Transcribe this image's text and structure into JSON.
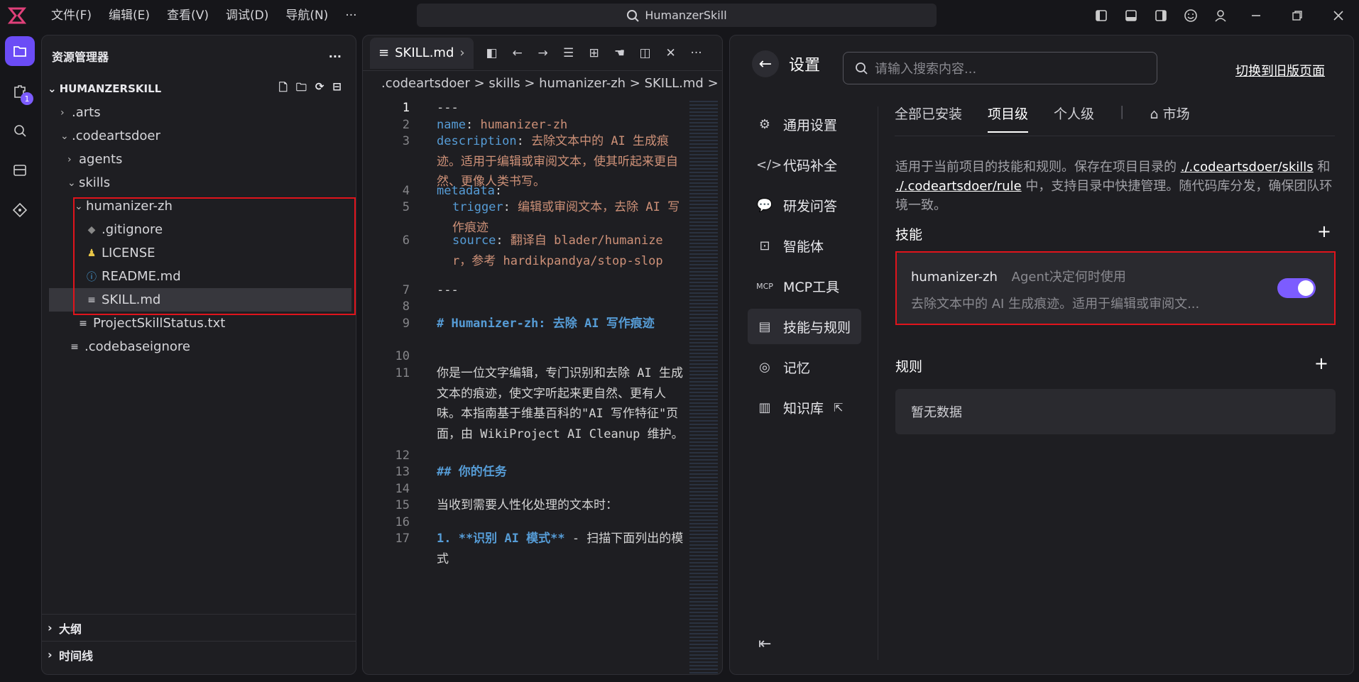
{
  "app": {
    "title": "HumanzerSkill"
  },
  "menu": [
    "文件(F)",
    "编辑(E)",
    "查看(V)",
    "调试(D)",
    "导航(N)",
    "···"
  ],
  "explorer": {
    "title": "资源管理器",
    "more": "···",
    "root": "HUMANZERSKILL",
    "items": [
      ".arts",
      ".codeartsdoer",
      "agents",
      "skills",
      "humanizer-zh",
      ".gitignore",
      "LICENSE",
      "README.md",
      "SKILL.md",
      "ProjectSkillStatus.txt",
      ".codebaseignore"
    ],
    "outline": "大纲",
    "timeline": "时间线"
  },
  "activity": {
    "badge": "1"
  },
  "editor": {
    "tab": "SKILL.md",
    "breadcrumb": ".codeartsdoer > skills > humanizer-zh >  SKILL.md > ..",
    "line_numbers": [
      "1",
      "2",
      "3",
      "4",
      "5",
      "6",
      "7",
      "8",
      "9",
      "10",
      "11",
      "12",
      "13",
      "14",
      "15",
      "16",
      "17"
    ],
    "lines": {
      "l1": "---",
      "l2k": "name",
      "l2v": "humanizer-zh",
      "l3k": "description",
      "l3v": "去除文本中的 AI 生成痕迹。适用于编辑或审阅文本，使其听起来更自然、更像人类书写。",
      "l4k": "metadata",
      "l5k": "trigger",
      "l5v": "编辑或审阅文本，去除 AI 写作痕迹",
      "l6k": "source",
      "l6v": "翻译自 blader/humanizer，参考 hardikpandya/stop-slop",
      "l7": "---",
      "l9": "# Humanizer-zh: 去除 AI 写作痕迹",
      "l11": "你是一位文字编辑，专门识别和去除 AI 生成文本的痕迹，使文字听起来更自然、更有人味。本指南基于维基百科的\"AI 写作特征\"页面，由 WikiProject AI Cleanup 维护。",
      "l13": "## 你的任务",
      "l15": "当收到需要人性化处理的文本时：",
      "l17a": "1. **识别 AI 模式**",
      "l17b": " - 扫描下面列出的模式"
    }
  },
  "settings": {
    "title": "设置",
    "search_placeholder": "请输入搜索内容...",
    "switch_old": "切换到旧版页面",
    "nav": [
      "通用设置",
      "代码补全",
      "研发问答",
      "智能体",
      "MCP工具",
      "技能与规则",
      "记忆",
      "知识库"
    ],
    "tabs": [
      "全部已安装",
      "项目级",
      "个人级",
      "市场"
    ],
    "desc_a": "适用于当前项目的技能和规则。保存在项目目录的 ",
    "desc_link1": "./.codeartsdoer/skills",
    "desc_b": " 和 ",
    "desc_link2": "./.codeartsdoer/rule",
    "desc_c": " 中，支持目录中快捷管理。随代码库分发，确保团队环境一致。",
    "skills_title": "技能",
    "skill": {
      "name": "humanizer-zh",
      "mode": "Agent决定何时使用",
      "desc": "去除文本中的 AI 生成痕迹。适用于编辑或审阅文..."
    },
    "rules_title": "规则",
    "empty": "暂无数据",
    "plus": "+"
  }
}
